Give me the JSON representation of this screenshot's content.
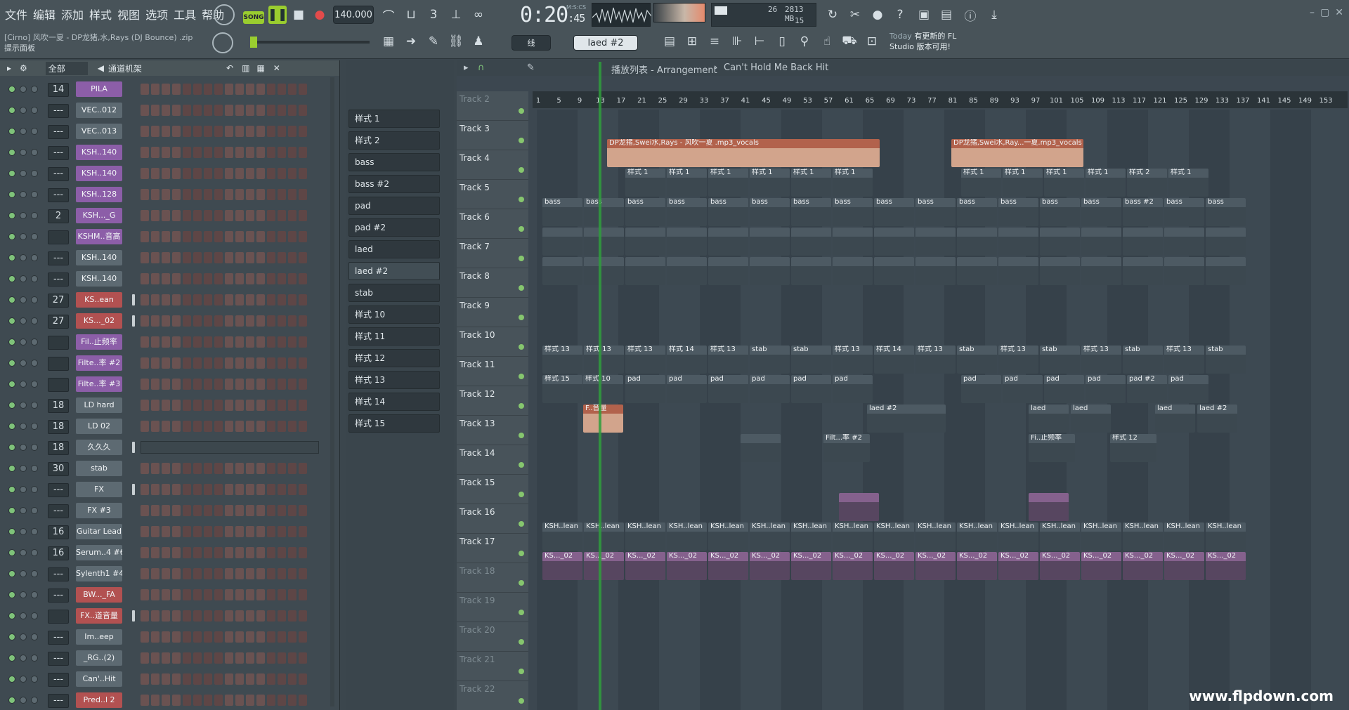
{
  "menu": [
    "文件",
    "编辑",
    "添加",
    "样式",
    "视图",
    "选项",
    "工具",
    "帮助"
  ],
  "hint": {
    "file": "[Cirno] 风吹一夏 - DP龙猪,水,Rays (DJ Bounce) .zip",
    "panel": "提示面板"
  },
  "transport": {
    "song_label": "SONG",
    "tempo": "140.000",
    "time": "0:20",
    "time_sub": ":45",
    "time_unit": "M:S:CS",
    "snap": "线",
    "pattern": "laed #2"
  },
  "cpu": {
    "mem": "2813 MB",
    "voices": "26",
    "poly": "15"
  },
  "news": {
    "today": "Today",
    "line1": "有更新的 FL",
    "line2": "Studio 版本可用!"
  },
  "rack": {
    "filter": "全部",
    "title": "通道机架"
  },
  "channels": [
    {
      "mix": "14",
      "name": "PILA",
      "color": "p"
    },
    {
      "mix": "---",
      "name": "VEC..012",
      "color": "g"
    },
    {
      "mix": "---",
      "name": "VEC..013",
      "color": "g"
    },
    {
      "mix": "---",
      "name": "KSH..140",
      "color": "p"
    },
    {
      "mix": "---",
      "name": "KSH..140",
      "color": "p"
    },
    {
      "mix": "---",
      "name": "KSH..128",
      "color": "p"
    },
    {
      "mix": "2",
      "name": "KSH..._G",
      "color": "p"
    },
    {
      "mix": "",
      "name": "KSHM..音高",
      "color": "p"
    },
    {
      "mix": "---",
      "name": "KSH..140",
      "color": "g"
    },
    {
      "mix": "---",
      "name": "KSH..140",
      "color": "g"
    },
    {
      "mix": "27",
      "name": "KS..ean",
      "color": "r"
    },
    {
      "mix": "27",
      "name": "KS..._02",
      "color": "r"
    },
    {
      "mix": "",
      "name": "Fil..止频率",
      "color": "p"
    },
    {
      "mix": "",
      "name": "Filte..率 #2",
      "color": "p"
    },
    {
      "mix": "",
      "name": "Filte..率 #3",
      "color": "p"
    },
    {
      "mix": "18",
      "name": "LD hard",
      "color": "g"
    },
    {
      "mix": "18",
      "name": "LD 02",
      "color": "g"
    },
    {
      "mix": "18",
      "name": "久久久",
      "color": "g"
    },
    {
      "mix": "30",
      "name": "stab",
      "color": "g"
    },
    {
      "mix": "---",
      "name": "FX",
      "color": "g"
    },
    {
      "mix": "---",
      "name": "FX #3",
      "color": "g"
    },
    {
      "mix": "16",
      "name": "Guitar Lead",
      "color": "g"
    },
    {
      "mix": "16",
      "name": "Serum..4 #6",
      "color": "g"
    },
    {
      "mix": "---",
      "name": "Sylenth1 #4",
      "color": "g"
    },
    {
      "mix": "---",
      "name": "BW..._FA",
      "color": "r"
    },
    {
      "mix": "",
      "name": "FX..道音量",
      "color": "r"
    },
    {
      "mix": "---",
      "name": "Im..eep",
      "color": "g"
    },
    {
      "mix": "---",
      "name": "_RG..(2)",
      "color": "g"
    },
    {
      "mix": "---",
      "name": "Can'..Hit",
      "color": "g"
    },
    {
      "mix": "---",
      "name": "Pred..l 2",
      "color": "r"
    }
  ],
  "patterns": [
    "样式 1",
    "样式 2",
    "bass",
    "bass #2",
    "pad",
    "pad #2",
    "laed",
    "laed #2",
    "stab",
    "样式 10",
    "样式 11",
    "样式 12",
    "样式 13",
    "样式 14",
    "样式 15"
  ],
  "arrangement": {
    "title": "播放列表 - Arrangement",
    "crumb": "Can't Hold Me Back Hit"
  },
  "tracks": [
    "Track 2",
    "Track 3",
    "Track 4",
    "Track 5",
    "Track 6",
    "Track 7",
    "Track 8",
    "Track 9",
    "Track 10",
    "Track 11",
    "Track 12",
    "Track 13",
    "Track 14",
    "Track 15",
    "Track 16",
    "Track 17",
    "Track 18",
    "Track 19",
    "Track 20",
    "Track 21",
    "Track 22"
  ],
  "ruler": [
    "1",
    "5",
    "9",
    "13",
    "17",
    "21",
    "25",
    "29",
    "33",
    "37",
    "41",
    "45",
    "49",
    "53",
    "57",
    "61",
    "65",
    "69",
    "73",
    "77",
    "81",
    "85",
    "89",
    "93",
    "97",
    "101",
    "105",
    "109",
    "113",
    "117",
    "121",
    "125",
    "129",
    "133",
    "137",
    "141",
    "145",
    "149",
    "153"
  ],
  "clips": {
    "vocal1": "DP龙猪,Swei水,Rays - 风吹一夏 .mp3_vocals",
    "vocal2": "DP龙猪,Swei水,Ray...一夏.mp3_vocals",
    "p1": "样式 1",
    "bass": "bass",
    "bass2": "bass #2",
    "p13": "样式 13",
    "stab": "stab",
    "p15": "样式 15",
    "p10": "样式 10",
    "pad": "pad",
    "pad2": "pad #2",
    "fvol": "F..音量",
    "laed": "laed",
    "laed2": "laed #2",
    "filt2": "Filt...率 #2",
    "filt": "Fi..止频率",
    "p12": "样式 12",
    "ksh": "KSH..lean",
    "ks02": "KS..._02",
    "p14": "样式 14",
    "p2": "样式 2"
  },
  "watermark": "www.flpdown.com",
  "colors": {
    "accent": "#8c5ea8",
    "playhead": "#2f9e3c",
    "vocal": "#d2a48c"
  }
}
